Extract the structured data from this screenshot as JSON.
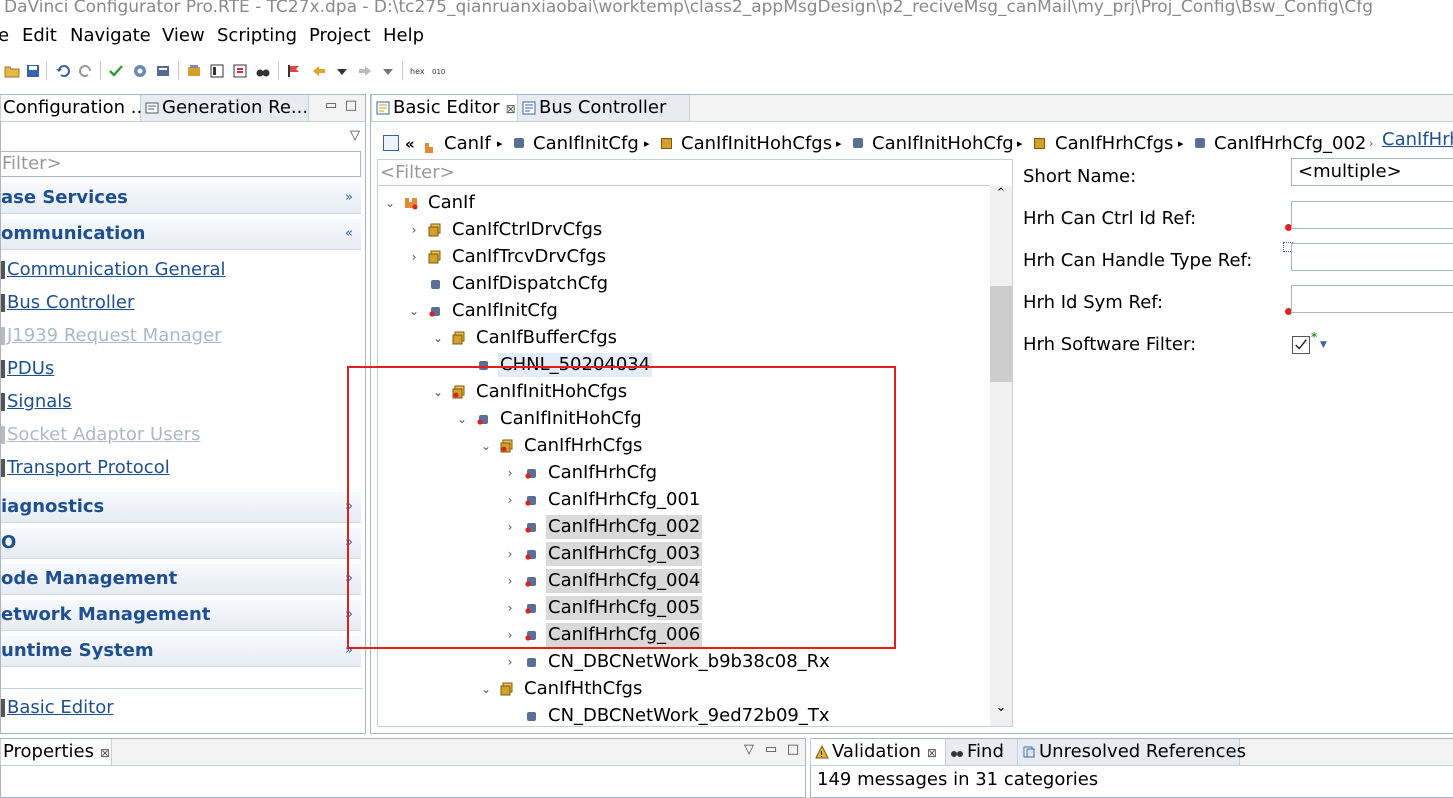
{
  "window": {
    "title": "DaVinci Configurator Pro.RTE - TC27x.dpa - D:\\tc275_qianruanxiaobai\\worktemp\\class2_appMsgDesign\\p2_reciveMsg_canMail\\my_prj\\Proj_Config\\Bsw_Config\\Cfg"
  },
  "menu": {
    "items": [
      "e",
      "Edit",
      "Navigate",
      "View",
      "Scripting",
      "Project",
      "Help"
    ]
  },
  "left_panel": {
    "tabs": [
      "Configuration ...",
      "Generation Re..."
    ],
    "filter_placeholder": "Filter>",
    "sections": [
      {
        "label": "ase Services",
        "expanded": false
      },
      {
        "label": "ommunication",
        "expanded": true
      },
      {
        "label": "iagnostics",
        "expanded": false
      },
      {
        "label": "O",
        "expanded": false
      },
      {
        "label": "ode Management",
        "expanded": false
      },
      {
        "label": "etwork Management",
        "expanded": false
      },
      {
        "label": "untime System",
        "expanded": false
      }
    ],
    "communication_links": [
      {
        "label": "Communication General",
        "enabled": true
      },
      {
        "label": "Bus Controller",
        "enabled": true
      },
      {
        "label": "J1939 Request Manager",
        "enabled": false
      },
      {
        "label": "PDUs",
        "enabled": true
      },
      {
        "label": "Signals",
        "enabled": true
      },
      {
        "label": "Socket Adaptor Users",
        "enabled": false
      },
      {
        "label": "Transport Protocol",
        "enabled": true
      }
    ],
    "bottom_link": "Basic Editor"
  },
  "editor": {
    "tabs": [
      "Basic Editor",
      "Bus Controller"
    ],
    "breadcrumb": [
      "CanIf",
      "CanIfInitCfg",
      "CanIfInitHohCfgs",
      "CanIfInitHohCfg",
      "CanIfHrhCfgs",
      "CanIfHrhCfg_002",
      "CanIfHrh"
    ],
    "filter_placeholder": "<Filter>",
    "tree": [
      {
        "label": "CanIf",
        "expander": "open"
      },
      {
        "label": "CanIfCtrlDrvCfgs",
        "expander": "closed"
      },
      {
        "label": "CanIfTrcvDrvCfgs",
        "expander": "closed"
      },
      {
        "label": "CanIfDispatchCfg",
        "expander": "none"
      },
      {
        "label": "CanIfInitCfg",
        "expander": "open"
      },
      {
        "label": "CanIfBufferCfgs",
        "expander": "open"
      },
      {
        "label": "CHNL_50204034",
        "expander": "none"
      },
      {
        "label": "CanIfInitHohCfgs",
        "expander": "open"
      },
      {
        "label": "CanIfInitHohCfg",
        "expander": "open"
      },
      {
        "label": "CanIfHrhCfgs",
        "expander": "open"
      },
      {
        "label": "CanIfHrhCfg",
        "expander": "closed"
      },
      {
        "label": "CanIfHrhCfg_001",
        "expander": "closed"
      },
      {
        "label": "CanIfHrhCfg_002",
        "expander": "closed",
        "selected": true
      },
      {
        "label": "CanIfHrhCfg_003",
        "expander": "closed",
        "selected": true
      },
      {
        "label": "CanIfHrhCfg_004",
        "expander": "closed",
        "selected": true
      },
      {
        "label": "CanIfHrhCfg_005",
        "expander": "closed",
        "selected": true
      },
      {
        "label": "CanIfHrhCfg_006",
        "expander": "closed",
        "selected": true
      },
      {
        "label": "CN_DBCNetWork_b9b38c08_Rx",
        "expander": "closed"
      },
      {
        "label": "CanIfHthCfgs",
        "expander": "open"
      },
      {
        "label": "CN_DBCNetWork_9ed72b09_Tx",
        "expander": "none"
      }
    ],
    "properties": {
      "short_name_label": "Short Name:",
      "short_name_value": "<multiple>",
      "hrh_can_ctrl_id_ref_label": "Hrh Can Ctrl Id Ref:",
      "hrh_can_handle_type_ref_label": "Hrh Can Handle Type Ref:",
      "hrh_id_sym_ref_label": "Hrh Id Sym Ref:",
      "hrh_software_filter_label": "Hrh Software Filter:",
      "hrh_software_filter_checked": true
    }
  },
  "bottom_left": {
    "tabs": [
      "Properties"
    ]
  },
  "bottom_right": {
    "tabs": [
      "Validation",
      "Find",
      "Unresolved References"
    ],
    "status": "149 messages in 31 categories"
  },
  "colors": {
    "link": "#1d4f91",
    "highlight_box": "#e02020",
    "selection": "#d9d9d9"
  }
}
